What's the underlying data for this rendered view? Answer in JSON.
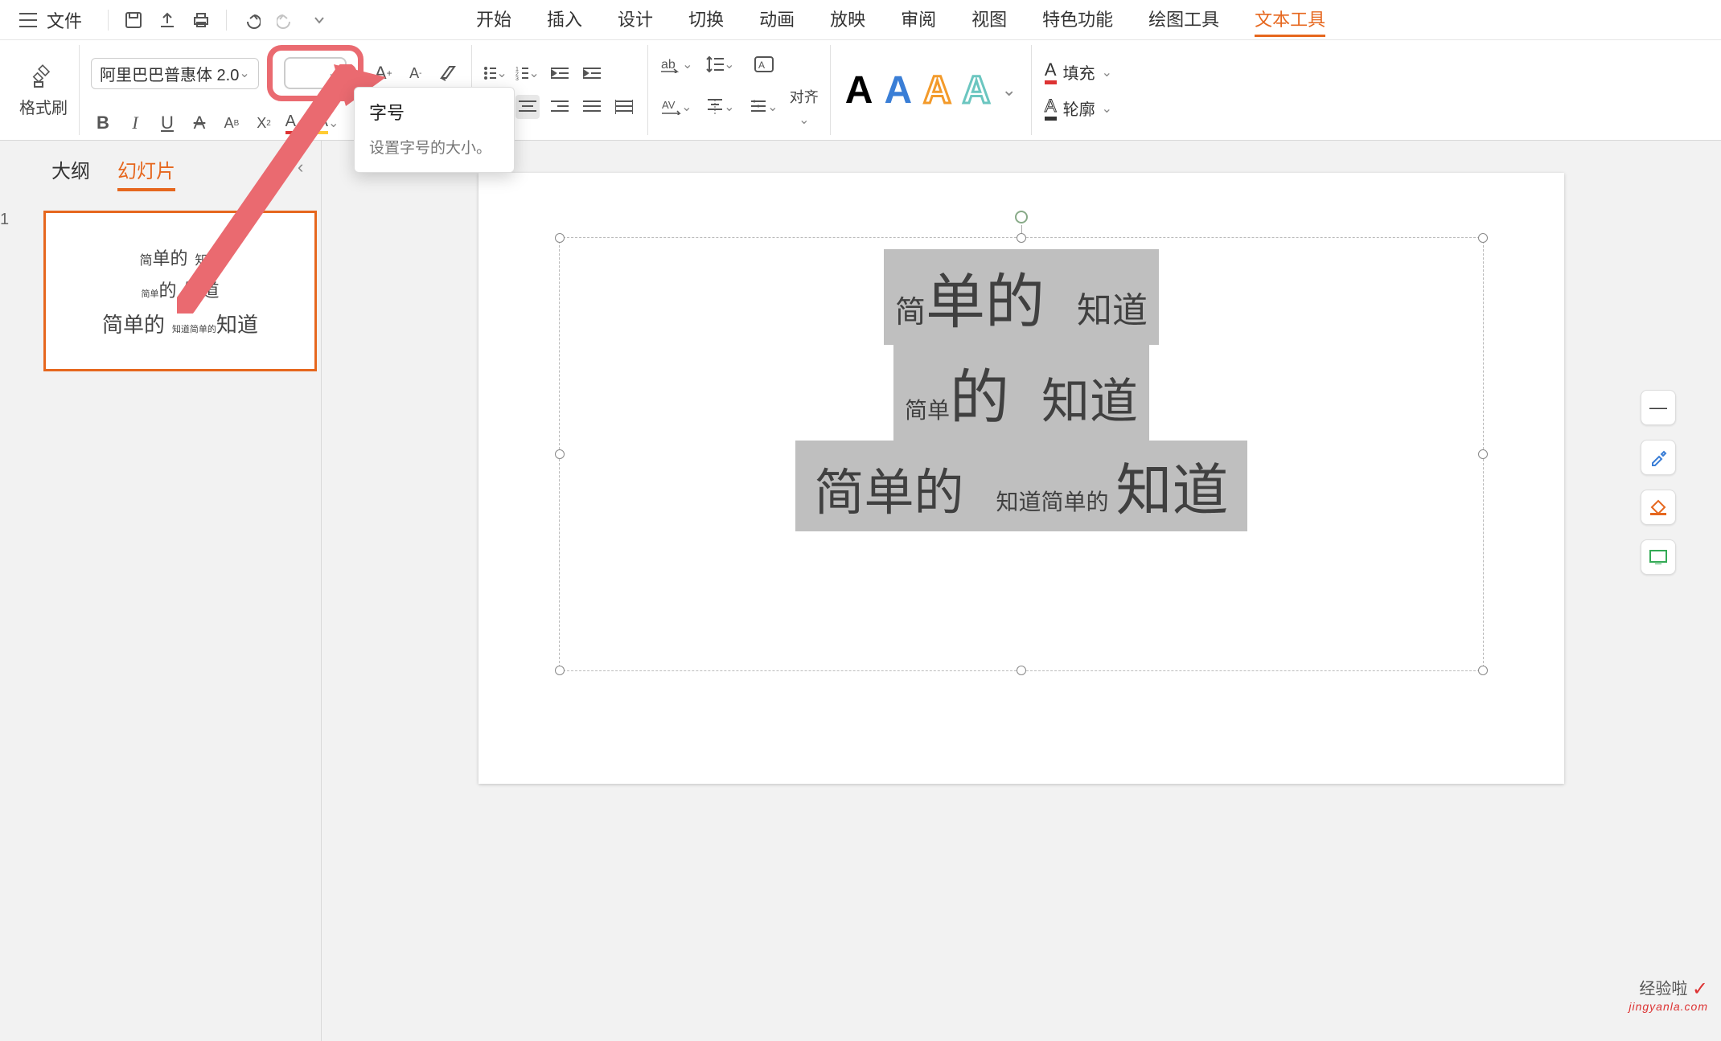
{
  "menu": {
    "file": "文件"
  },
  "tabs": [
    "开始",
    "插入",
    "设计",
    "切换",
    "动画",
    "放映",
    "审阅",
    "视图",
    "特色功能",
    "绘图工具",
    "文本工具"
  ],
  "tabs_active_index": 10,
  "ribbon": {
    "format_painter": "格式刷",
    "font_name": "阿里巴巴普惠体 2.0",
    "font_size": "",
    "align_label": "对齐"
  },
  "fill_outline": {
    "fill": "填充",
    "outline": "轮廓"
  },
  "tooltip": {
    "title": "字号",
    "desc": "设置字号的大小。"
  },
  "side": {
    "tabs": [
      "大纲",
      "幻灯片"
    ],
    "active": 1,
    "slide_number": "1"
  },
  "thumb": {
    "l1a": "简",
    "l1b": "单的",
    "l1c": "知道",
    "l2a": "简单",
    "l2b": "的",
    "l2c": "知道",
    "l3a": "简单的",
    "l3b": "知道简单的",
    "l3c": "知道"
  },
  "slide": {
    "l1a": "简",
    "l1b": "单的",
    "l1c": "知道",
    "l2a": "简单",
    "l2b": "的",
    "l2c": "知道",
    "l3a": "简单的",
    "l3b": "知道简单的",
    "l3c": "知道"
  },
  "watermark": {
    "text": "经验啦",
    "domain": "jingyanla.com"
  }
}
